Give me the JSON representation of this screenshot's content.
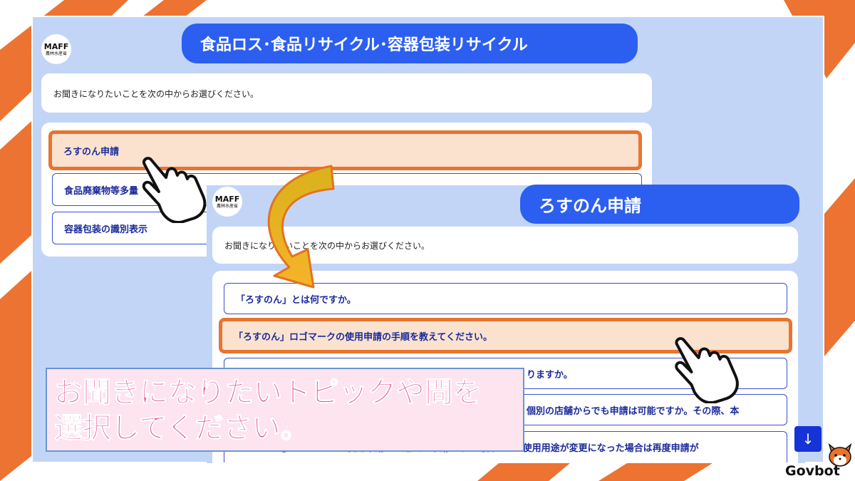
{
  "brand": {
    "logo_text": "MAFF",
    "logo_sub": "農林水産省",
    "bot_name": "Govbot"
  },
  "screen1": {
    "title": "食品ロス･食品リサイクル･容器包装リサイクル",
    "prompt": "お聞きになりたいことを次の中からお選びください。",
    "options": [
      "ろすのん申請",
      "食品廃棄物等多量",
      "容器包装の識別表示"
    ]
  },
  "screen2": {
    "title": "ろすのん申請",
    "prompt": "お聞きになりたいことを次の中からお選びください。",
    "options": [
      "「ろすのん」とは何ですか。",
      "「ろすのん」ロゴマークの使用申請の手順を教えてください。",
      "りますか。",
      "個別の店舗からでも申請は可能ですか。その際、本",
      "「ろすのん」ロゴマークの使用申請は、過去に申請をした場合でも、使用用途が変更になった場合は再度申請が"
    ]
  },
  "caption": {
    "line1": "お聞きになりたいトピックや問を",
    "line2": "選択してください。"
  },
  "scroll_button": "↓",
  "colors": {
    "accent_blue": "#2c5ff0",
    "highlight_orange": "#e8742f",
    "caption_pink": "#ea4c8c",
    "background_blue": "#c3d5f7"
  }
}
